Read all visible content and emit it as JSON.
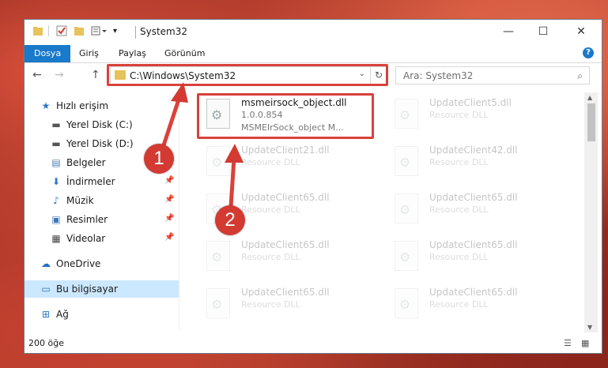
{
  "window": {
    "title": "System32",
    "min": "—",
    "max": "☐",
    "close": "✕"
  },
  "ribbon": {
    "tabs": [
      "Dosya",
      "Giriş",
      "Paylaş",
      "Görünüm"
    ],
    "help": "?"
  },
  "address": {
    "path": "C:\\Windows\\System32",
    "refresh": "↻",
    "drop": "⌄"
  },
  "search": {
    "placeholder": "Ara: System32",
    "icon": "⌕"
  },
  "nav": {
    "back": "←",
    "forward": "→",
    "up": "↑",
    "items": [
      {
        "label": "Hızlı erişim",
        "icon": "★",
        "color": "#2a77c8"
      },
      {
        "label": "Yerel Disk (C:)",
        "icon": "▬",
        "color": "#555555"
      },
      {
        "label": "Yerel Disk (D:)",
        "icon": "▬",
        "color": "#555555"
      },
      {
        "label": "Belgeler",
        "icon": "▤",
        "color": "#4a7fb4"
      },
      {
        "label": "İndirmeler",
        "icon": "⬇",
        "color": "#2a77c8"
      },
      {
        "label": "Müzik",
        "icon": "♪",
        "color": "#2a77c8"
      },
      {
        "label": "Resimler",
        "icon": "▣",
        "color": "#3a78b8"
      },
      {
        "label": "Videolar",
        "icon": "▦",
        "color": "#444444"
      },
      {
        "label": "OneDrive",
        "icon": "☁",
        "color": "#1e6fc8"
      },
      {
        "label": "Bu bilgisayar",
        "icon": "▭",
        "color": "#2a77c8"
      },
      {
        "label": "Ağ",
        "icon": "⊞",
        "color": "#2a77c8"
      }
    ]
  },
  "files": [
    {
      "name": "msmeirsock_object.dll",
      "line2": "1.0.0.854",
      "line3": "MSMEIrSock_object M..."
    },
    {
      "name": "UpdateClient5.dll",
      "line2": "Resource DLL"
    },
    {
      "name": "UpdateClient21.dll",
      "line2": "Resource DLL"
    },
    {
      "name": "UpdateClient42.dll",
      "line2": "Resource DLL"
    },
    {
      "name": "UpdateClient65.dll",
      "line2": "Resource DLL"
    },
    {
      "name": "UpdateClient65.dll",
      "line2": "Resource DLL"
    },
    {
      "name": "UpdateClient65.dll",
      "line2": "Resource DLL"
    },
    {
      "name": "UpdateClient65.dll",
      "line2": "Resource DLL"
    },
    {
      "name": "UpdateClient65.dll",
      "line2": "Resource DLL"
    },
    {
      "name": "UpdateClient65.dll",
      "line2": "Resource DLL"
    }
  ],
  "status": {
    "count": "200 öğe"
  },
  "annotations": {
    "one": "1",
    "two": "2",
    "color": "#d33a32"
  }
}
